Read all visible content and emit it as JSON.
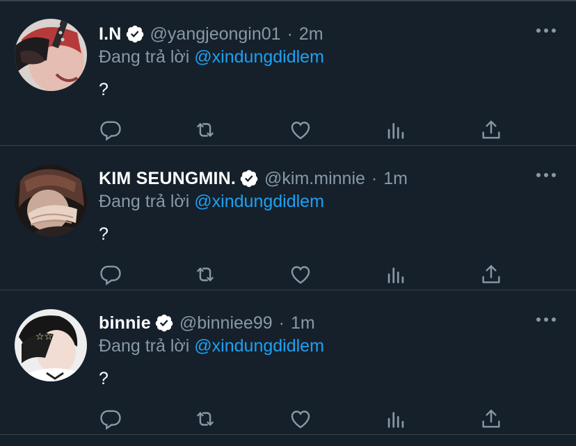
{
  "tweets": [
    {
      "name": "I.N",
      "handle": "@yangjeongin01",
      "time": "2m",
      "reply_prefix": "Đang trả lời",
      "reply_to": "@xindungdidlem",
      "text": "?"
    },
    {
      "name": "KIM SEUNGMIN.",
      "handle": "@kim.minnie",
      "time": "1m",
      "reply_prefix": "Đang trả lời",
      "reply_to": "@xindungdidlem",
      "text": "?"
    },
    {
      "name": "binnie",
      "handle": "@binniee99",
      "time": "1m",
      "reply_prefix": "Đang trả lời",
      "reply_to": "@xindungdidlem",
      "text": "?"
    }
  ],
  "separator": "·",
  "icons": {
    "verified": "verified-badge-icon",
    "more": "more-dots-icon",
    "reply": "reply-icon",
    "retweet": "retweet-icon",
    "like": "heart-icon",
    "analytics": "analytics-icon",
    "share": "share-icon"
  },
  "colors": {
    "background": "#15202b",
    "divider": "#38444d",
    "secondary_text": "#8899a6",
    "mention": "#1da1f2",
    "primary_text": "#ffffff"
  }
}
